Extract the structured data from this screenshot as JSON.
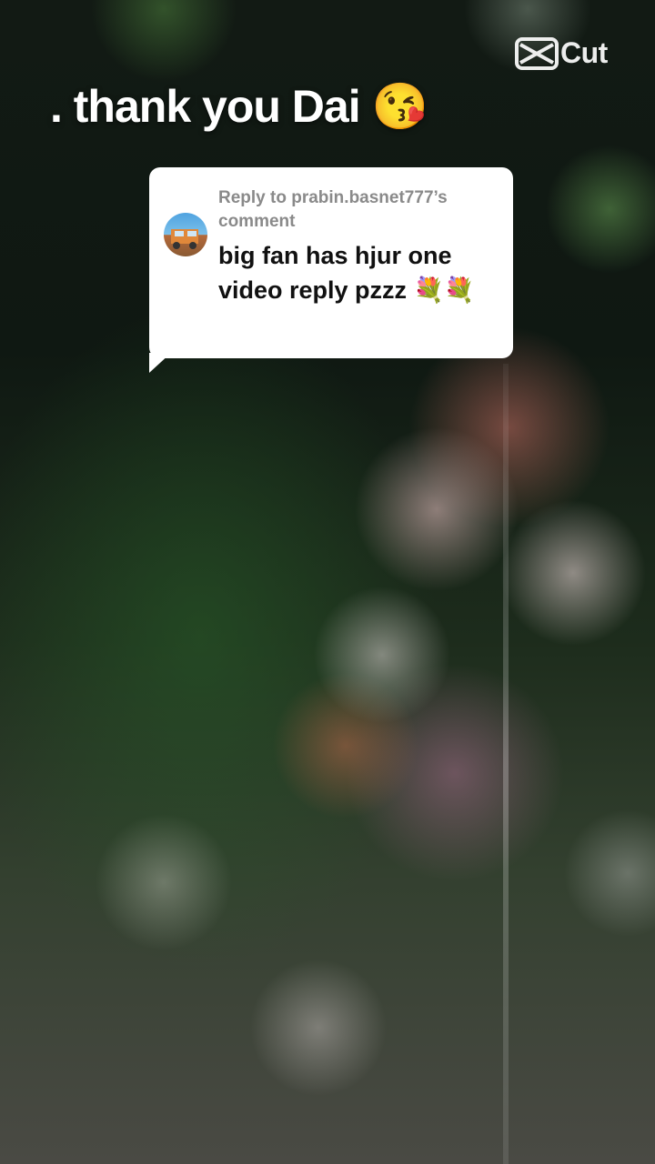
{
  "caption": {
    "text": ". thank you Dai 😘"
  },
  "watermark": {
    "label": "Cut",
    "icon": "capcut-logo-icon"
  },
  "reply_bubble": {
    "reply_to": "Reply to prabin.basnet777’s comment",
    "comment": "big fan has hjur one video reply pzzz 💐💐",
    "avatar_icon": "truck-avatar-icon"
  },
  "colors": {
    "bubble": "#ffffff",
    "reply_to_text": "#8a8a8a",
    "comment_text": "#111111",
    "caption_text": "#ffffff"
  }
}
